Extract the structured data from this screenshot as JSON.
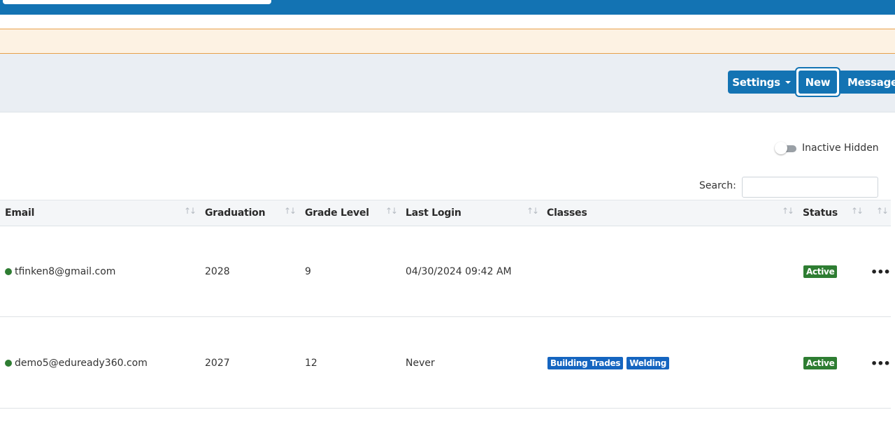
{
  "toolbar": {
    "settings_label": "Settings",
    "new_label": "New",
    "message_label": "Message"
  },
  "filters": {
    "toggle_label": "Inactive Hidden",
    "search_label": "Search:",
    "search_value": ""
  },
  "table": {
    "headers": [
      "Email",
      "Graduation",
      "Grade Level",
      "Last Login",
      "Classes",
      "Status"
    ],
    "sort_icon": "sort-arrows-icon",
    "rows": [
      {
        "email": "tfinken8@gmail.com",
        "graduation": "2028",
        "grade_level": "9",
        "last_login": "04/30/2024 09:42 AM",
        "classes": [],
        "status": "Active",
        "actions": "•••"
      },
      {
        "email": "demo5@eduready360.com",
        "graduation": "2027",
        "grade_level": "12",
        "last_login": "Never",
        "classes": [
          "Building Trades",
          "Welding"
        ],
        "status": "Active",
        "actions": "•••"
      }
    ]
  },
  "colors": {
    "primary": "#1373b3",
    "notice_bg": "#fdf2e3",
    "notice_border": "#e8a04a",
    "active_green": "#2e7d32",
    "class_blue": "#1565c0"
  }
}
